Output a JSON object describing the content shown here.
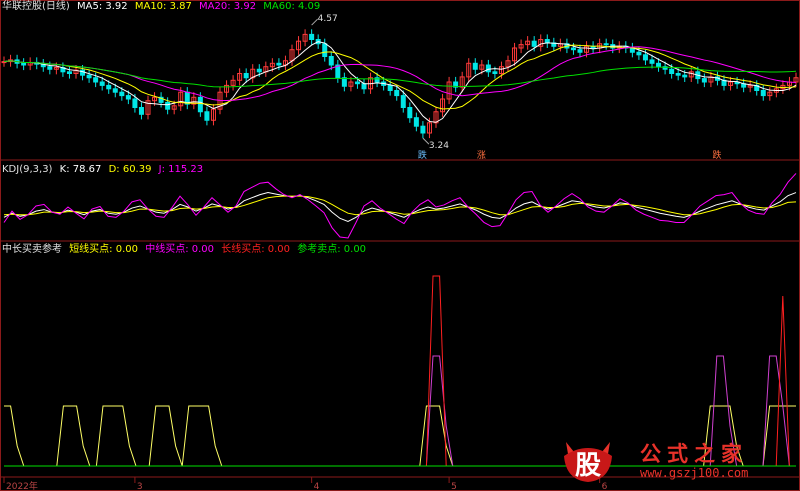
{
  "panel1": {
    "title": "华联控股(日线)",
    "ma": [
      {
        "label": "MA5: 3.92",
        "color": "#ffffff"
      },
      {
        "label": "MA10: 3.87",
        "color": "#ffff00"
      },
      {
        "label": "MA20: 3.92",
        "color": "#ff00ff"
      },
      {
        "label": "MA60: 4.09",
        "color": "#00e000"
      }
    ],
    "high_label": "4.57",
    "low_label": "3.24",
    "tags": [
      "跌",
      "涨",
      "跌"
    ]
  },
  "panel2": {
    "title": "KDJ(9,3,3)",
    "items": [
      {
        "label": "K: 78.67",
        "color": "#ffffff"
      },
      {
        "label": "D: 60.39",
        "color": "#ffff00"
      },
      {
        "label": "J: 115.23",
        "color": "#ff00ff"
      }
    ]
  },
  "panel3": {
    "title": "中长买卖参考",
    "items": [
      {
        "label": "短线买点: 0.00",
        "color": "#ffff00"
      },
      {
        "label": "中线买点: 0.00",
        "color": "#ff00ff"
      },
      {
        "label": "长线买点: 0.00",
        "color": "#ff2020"
      },
      {
        "label": "参考卖点: 0.00",
        "color": "#00e000"
      }
    ]
  },
  "xaxis": {
    "labels": [
      {
        "text": "2022年",
        "i": 0
      },
      {
        "text": "3",
        "i": 20
      },
      {
        "text": "4",
        "i": 47
      },
      {
        "text": "5",
        "i": 68
      },
      {
        "text": "6",
        "i": 91
      }
    ]
  },
  "watermark": {
    "char": "股",
    "cn": "公式之家",
    "url": "www.gszj100.com"
  },
  "chart_data": [
    {
      "type": "candlestick",
      "title": "华联控股(日线)",
      "ylim": [
        3.1,
        4.7
      ],
      "annotations": [
        {
          "text": "4.57",
          "value": 4.57,
          "i": 47
        },
        {
          "text": "3.24",
          "value": 3.24,
          "i": 64
        }
      ],
      "closes": [
        4.14,
        4.16,
        4.12,
        4.1,
        4.13,
        4.11,
        4.08,
        4.05,
        4.07,
        4.02,
        4.0,
        4.04,
        3.98,
        3.95,
        3.9,
        3.86,
        3.82,
        3.78,
        3.74,
        3.7,
        3.6,
        3.52,
        3.68,
        3.72,
        3.66,
        3.58,
        3.62,
        3.78,
        3.64,
        3.72,
        3.55,
        3.45,
        3.58,
        3.78,
        3.86,
        3.92,
        4.0,
        3.95,
        4.05,
        4.02,
        4.08,
        4.12,
        4.1,
        4.15,
        4.28,
        4.38,
        4.46,
        4.4,
        4.35,
        4.2,
        4.1,
        3.95,
        3.85,
        3.9,
        3.88,
        3.82,
        3.95,
        3.9,
        3.86,
        3.8,
        3.74,
        3.6,
        3.48,
        3.38,
        3.3,
        3.42,
        3.55,
        3.7,
        3.9,
        3.84,
        3.96,
        4.12,
        4.05,
        4.1,
        4.02,
        4.0,
        4.08,
        4.15,
        4.3,
        4.34,
        4.38,
        4.32,
        4.4,
        4.36,
        4.32,
        4.35,
        4.3,
        4.28,
        4.25,
        4.32,
        4.3,
        4.35,
        4.34,
        4.3,
        4.32,
        4.3,
        4.25,
        4.22,
        4.16,
        4.12,
        4.08,
        4.05,
        4.0,
        3.98,
        3.96,
        4.02,
        3.94,
        3.9,
        3.96,
        3.92,
        3.86,
        3.9,
        3.88,
        3.84,
        3.86,
        3.8,
        3.74,
        3.78,
        3.82,
        3.86,
        3.9,
        3.95
      ]
    },
    {
      "type": "line",
      "title": "KDJ(9,3,3)",
      "ylim": [
        -10,
        110
      ],
      "series": [
        {
          "name": "K",
          "values": [
            30,
            38,
            32,
            35,
            42,
            45,
            40,
            38,
            44,
            40,
            35,
            42,
            45,
            38,
            36,
            40,
            48,
            52,
            46,
            40,
            38,
            45,
            55,
            50,
            42,
            48,
            56,
            52,
            46,
            50,
            62,
            68,
            74,
            78,
            75,
            72,
            70,
            72,
            68,
            62,
            55,
            40,
            28,
            22,
            30,
            42,
            48,
            44,
            40,
            35,
            30,
            38,
            45,
            50,
            46,
            48,
            52,
            56,
            50,
            44,
            36,
            30,
            28,
            36,
            48,
            56,
            60,
            52,
            46,
            50,
            56,
            62,
            60,
            54,
            50,
            48,
            52,
            58,
            56,
            50,
            46,
            42,
            38,
            35,
            32,
            30,
            35,
            42,
            48,
            54,
            58,
            62,
            56,
            50,
            46,
            44,
            52,
            60,
            72,
            78
          ]
        },
        {
          "name": "D",
          "values": [
            35,
            36,
            35,
            35,
            37,
            40,
            40,
            39,
            41,
            41,
            39,
            40,
            42,
            41,
            39,
            39,
            42,
            46,
            46,
            44,
            42,
            43,
            47,
            48,
            46,
            47,
            50,
            51,
            49,
            49,
            53,
            58,
            63,
            68,
            70,
            71,
            71,
            71,
            70,
            67,
            63,
            55,
            46,
            38,
            35,
            37,
            41,
            42,
            41,
            39,
            36,
            37,
            40,
            43,
            44,
            45,
            47,
            50,
            50,
            48,
            44,
            39,
            35,
            35,
            40,
            45,
            50,
            51,
            49,
            49,
            51,
            55,
            57,
            56,
            54,
            52,
            52,
            54,
            55,
            53,
            51,
            48,
            45,
            41,
            38,
            35,
            35,
            37,
            41,
            45,
            50,
            54,
            55,
            53,
            50,
            48,
            49,
            53,
            59,
            60
          ]
        },
        {
          "name": "J",
          "values": [
            20,
            42,
            26,
            35,
            52,
            55,
            40,
            36,
            50,
            38,
            27,
            46,
            51,
            32,
            30,
            42,
            60,
            64,
            46,
            32,
            30,
            49,
            71,
            54,
            34,
            50,
            68,
            54,
            40,
            52,
            80,
            88,
            96,
            98,
            85,
            74,
            68,
            74,
            64,
            52,
            39,
            10,
            -8,
            -10,
            20,
            52,
            62,
            48,
            38,
            27,
            18,
            40,
            55,
            64,
            50,
            54,
            62,
            68,
            50,
            36,
            20,
            12,
            14,
            38,
            64,
            78,
            80,
            54,
            40,
            52,
            66,
            76,
            66,
            50,
            42,
            40,
            52,
            66,
            58,
            44,
            36,
            30,
            24,
            23,
            20,
            20,
            35,
            52,
            62,
            72,
            74,
            78,
            58,
            44,
            38,
            36,
            58,
            74,
            98,
            115
          ]
        }
      ]
    },
    {
      "type": "line",
      "title": "中长买卖参考",
      "ylim": [
        -0.05,
        1.05
      ],
      "series": [
        {
          "name": "短线买点",
          "values": [
            0.3,
            0.3,
            0.1,
            0,
            0,
            0,
            0,
            0,
            0,
            0.3,
            0.3,
            0.3,
            0.1,
            0,
            0,
            0.3,
            0.3,
            0.3,
            0.3,
            0.1,
            0,
            0,
            0,
            0.3,
            0.3,
            0.3,
            0.1,
            0,
            0.3,
            0.3,
            0.3,
            0.3,
            0.1,
            0,
            0,
            0,
            0,
            0,
            0,
            0,
            0,
            0,
            0,
            0,
            0,
            0,
            0,
            0,
            0,
            0,
            0,
            0,
            0,
            0,
            0,
            0,
            0,
            0,
            0,
            0,
            0,
            0,
            0,
            0,
            0.3,
            0.3,
            0.3,
            0.1,
            0,
            0,
            0,
            0,
            0,
            0,
            0,
            0,
            0,
            0,
            0,
            0,
            0,
            0,
            0,
            0,
            0,
            0,
            0,
            0,
            0,
            0,
            0,
            0,
            0,
            0,
            0,
            0,
            0,
            0,
            0,
            0,
            0,
            0,
            0,
            0,
            0,
            0,
            0,
            0.3,
            0.3,
            0.3,
            0.3,
            0.1,
            0,
            0,
            0,
            0,
            0.3,
            0.3,
            0.3,
            0.3,
            0.3
          ]
        },
        {
          "name": "中线买点",
          "values": [
            0,
            0,
            0,
            0,
            0,
            0,
            0,
            0,
            0,
            0,
            0,
            0,
            0,
            0,
            0,
            0,
            0,
            0,
            0,
            0,
            0,
            0,
            0,
            0,
            0,
            0,
            0,
            0,
            0,
            0,
            0,
            0,
            0,
            0,
            0,
            0,
            0,
            0,
            0,
            0,
            0,
            0,
            0,
            0,
            0,
            0,
            0,
            0,
            0,
            0,
            0,
            0,
            0,
            0,
            0,
            0,
            0,
            0,
            0,
            0,
            0,
            0,
            0,
            0,
            0,
            0.55,
            0.55,
            0.2,
            0,
            0,
            0,
            0,
            0,
            0,
            0,
            0,
            0,
            0,
            0,
            0,
            0,
            0,
            0,
            0,
            0,
            0,
            0,
            0,
            0,
            0,
            0,
            0,
            0,
            0,
            0,
            0,
            0,
            0,
            0,
            0,
            0,
            0,
            0,
            0,
            0,
            0,
            0,
            0,
            0.55,
            0.55,
            0.2,
            0,
            0,
            0,
            0,
            0,
            0.55,
            0.55,
            0.3,
            0,
            0
          ]
        },
        {
          "name": "长线买点",
          "values": [
            0,
            0,
            0,
            0,
            0,
            0,
            0,
            0,
            0,
            0,
            0,
            0,
            0,
            0,
            0,
            0,
            0,
            0,
            0,
            0,
            0,
            0,
            0,
            0,
            0,
            0,
            0,
            0,
            0,
            0,
            0,
            0,
            0,
            0,
            0,
            0,
            0,
            0,
            0,
            0,
            0,
            0,
            0,
            0,
            0,
            0,
            0,
            0,
            0,
            0,
            0,
            0,
            0,
            0,
            0,
            0,
            0,
            0,
            0,
            0,
            0,
            0,
            0,
            0,
            0,
            0.95,
            0.95,
            0,
            0,
            0,
            0,
            0,
            0,
            0,
            0,
            0,
            0,
            0,
            0,
            0,
            0,
            0,
            0,
            0,
            0,
            0,
            0,
            0,
            0,
            0,
            0,
            0,
            0,
            0,
            0,
            0,
            0,
            0,
            0,
            0,
            0,
            0,
            0,
            0,
            0,
            0,
            0,
            0,
            0,
            0,
            0,
            0,
            0,
            0,
            0,
            0,
            0,
            0,
            0.85,
            0,
            0
          ]
        },
        {
          "name": "参考卖点",
          "values": [
            0,
            0,
            0,
            0,
            0,
            0,
            0,
            0,
            0,
            0,
            0,
            0,
            0,
            0,
            0,
            0,
            0,
            0,
            0,
            0,
            0,
            0,
            0,
            0,
            0,
            0,
            0,
            0,
            0,
            0,
            0,
            0,
            0,
            0,
            0,
            0,
            0,
            0,
            0,
            0,
            0,
            0,
            0,
            0,
            0,
            0,
            0,
            0,
            0,
            0,
            0,
            0,
            0,
            0,
            0,
            0,
            0,
            0,
            0,
            0,
            0,
            0,
            0,
            0,
            0,
            0,
            0,
            0,
            0,
            0,
            0,
            0,
            0,
            0,
            0,
            0,
            0,
            0,
            0,
            0,
            0,
            0,
            0,
            0,
            0,
            0,
            0,
            0,
            0,
            0,
            0,
            0,
            0,
            0,
            0,
            0,
            0,
            0,
            0,
            0,
            0,
            0,
            0,
            0,
            0,
            0,
            0,
            0,
            0,
            0,
            0,
            0,
            0,
            0,
            0,
            0,
            0,
            0,
            0,
            0,
            0,
            0,
            0,
            0,
            0
          ]
        }
      ]
    }
  ]
}
